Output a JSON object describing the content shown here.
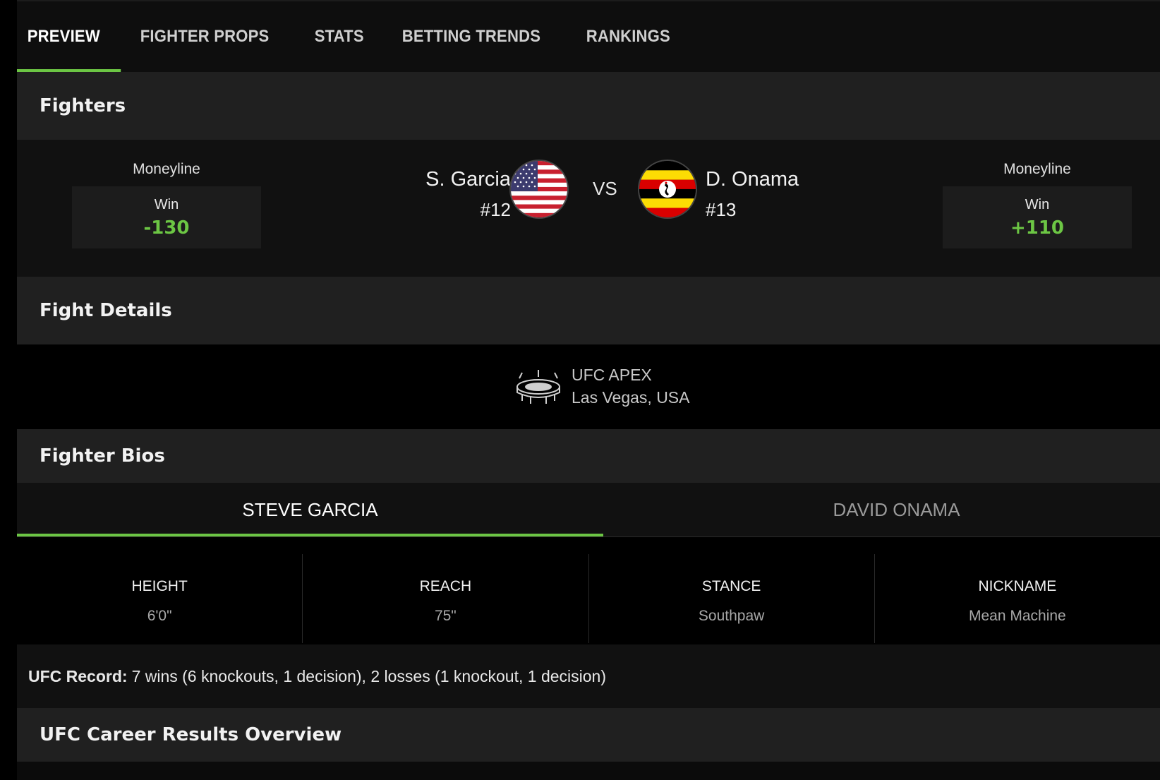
{
  "tabs": [
    {
      "label": "PREVIEW"
    },
    {
      "label": "FIGHTER PROPS"
    },
    {
      "label": "STATS"
    },
    {
      "label": "BETTING TRENDS"
    },
    {
      "label": "RANKINGS"
    }
  ],
  "colors": {
    "accent": "#6cc644",
    "background": "#000000",
    "panel": "#202020"
  },
  "fighters_section": {
    "title": "Fighters"
  },
  "matchup": {
    "left": {
      "moneyline_label": "Moneyline",
      "win_label": "Win",
      "odds": "-130",
      "name": "S. Garcia",
      "rank": "#12",
      "flag": "usa-flag-icon"
    },
    "vs": "VS",
    "right": {
      "moneyline_label": "Moneyline",
      "win_label": "Win",
      "odds": "+110",
      "name": "D. Onama",
      "rank": "#13",
      "flag": "uganda-flag-icon"
    }
  },
  "fight_details": {
    "title": "Fight Details",
    "venue": "UFC APEX",
    "location": "Las Vegas, USA",
    "icon": "arena-icon"
  },
  "bios": {
    "title": "Fighter Bios",
    "tabs": [
      {
        "label": "STEVE GARCIA"
      },
      {
        "label": "DAVID ONAMA"
      }
    ],
    "stats": [
      {
        "label": "HEIGHT",
        "value": "6'0\""
      },
      {
        "label": "REACH",
        "value": "75\""
      },
      {
        "label": "STANCE",
        "value": "Southpaw"
      },
      {
        "label": "NICKNAME",
        "value": "Mean Machine"
      }
    ],
    "record_label": "UFC Record:",
    "record_value": "7 wins (6 knockouts, 1 decision), 2 losses (1 knockout, 1 decision)"
  },
  "career": {
    "title": "UFC Career Results Overview"
  }
}
